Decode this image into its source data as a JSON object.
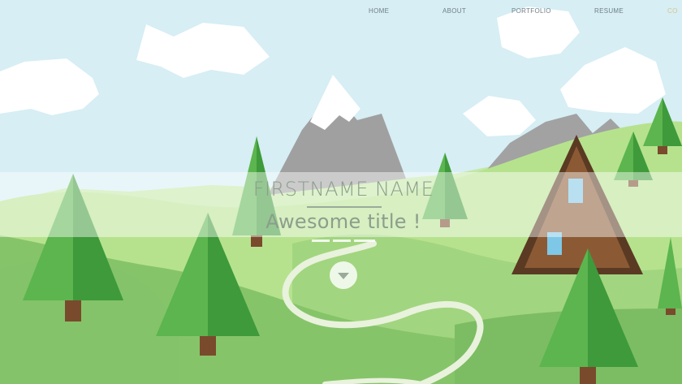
{
  "nav": {
    "items": [
      "HOME",
      "ABOUT",
      "PORTFOLIO",
      "RESUME",
      "CO"
    ],
    "accent_color": "#d9c48a",
    "text_color": "#6f7f86"
  },
  "hero": {
    "name": "FIRSTNAME NAME",
    "title": "Awesome title !"
  },
  "scroll_button": {
    "icon": "chevron-down-icon"
  },
  "colors": {
    "sky": "#d6eef4",
    "cloud": "#ffffff",
    "hill_light": "#b6e28e",
    "hill_mid": "#9fd07a",
    "hill_dark": "#82c06a",
    "tree_light": "#5cb54e",
    "tree_dark": "#3e9a3a",
    "trunk": "#7a4a2c",
    "mountain": "#a0a0a0",
    "snow": "#ffffff",
    "cabin": "#8b5a35",
    "path": "#e9f2dc"
  }
}
